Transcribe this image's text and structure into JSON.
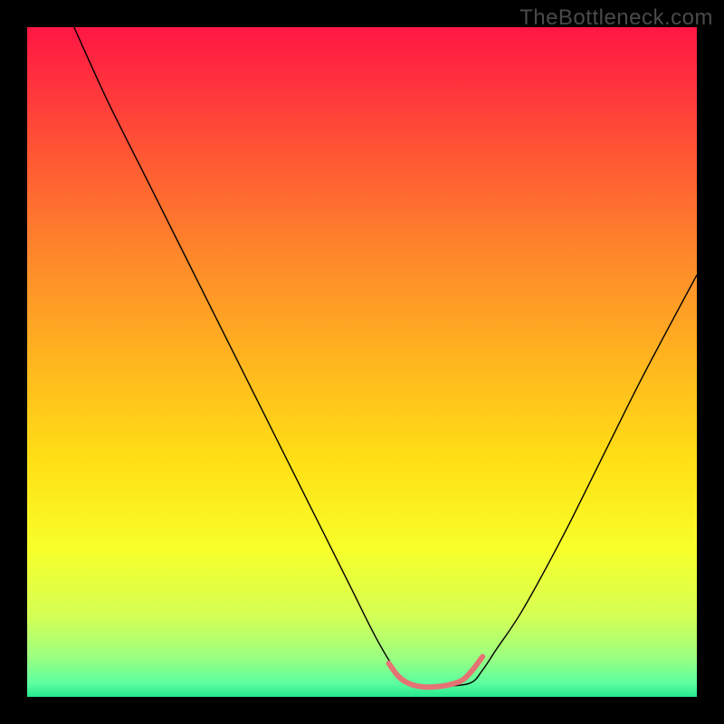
{
  "watermark": "TheBottleneck.com",
  "chart_data": {
    "type": "line",
    "title": "",
    "xlabel": "",
    "ylabel": "",
    "xlim": [
      0,
      100
    ],
    "ylim": [
      0,
      100
    ],
    "background_gradient_stops": [
      {
        "offset": 0.0,
        "color": "#ff1744"
      },
      {
        "offset": 0.06,
        "color": "#ff2a3f"
      },
      {
        "offset": 0.2,
        "color": "#ff5a33"
      },
      {
        "offset": 0.35,
        "color": "#ff8a2a"
      },
      {
        "offset": 0.5,
        "color": "#ffb61f"
      },
      {
        "offset": 0.65,
        "color": "#ffe015"
      },
      {
        "offset": 0.78,
        "color": "#f7ff2a"
      },
      {
        "offset": 0.88,
        "color": "#d4ff55"
      },
      {
        "offset": 0.94,
        "color": "#9cff80"
      },
      {
        "offset": 0.98,
        "color": "#5cffa0"
      },
      {
        "offset": 1.0,
        "color": "#25e88e"
      }
    ],
    "series": [
      {
        "name": "bottleneck-curve",
        "stroke": "#000000",
        "stroke_width": 1.4,
        "x": [
          7,
          12,
          18,
          24,
          30,
          36,
          42,
          48,
          52,
          55,
          57,
          59,
          61,
          66,
          68,
          70,
          74,
          80,
          86,
          92,
          100
        ],
        "y": [
          100,
          89,
          77,
          65,
          53,
          41,
          29,
          17,
          9,
          4,
          2,
          1.5,
          1.5,
          2,
          4,
          7,
          13,
          24,
          36,
          48,
          63
        ]
      },
      {
        "name": "valley-highlight",
        "stroke": "#e57373",
        "stroke_width": 6,
        "linecap": "round",
        "x": [
          54,
          55.5,
          57,
          59,
          61,
          63,
          65,
          66.5,
          68
        ],
        "y": [
          5,
          3,
          2,
          1.5,
          1.5,
          1.8,
          2.5,
          4,
          6
        ]
      }
    ]
  }
}
